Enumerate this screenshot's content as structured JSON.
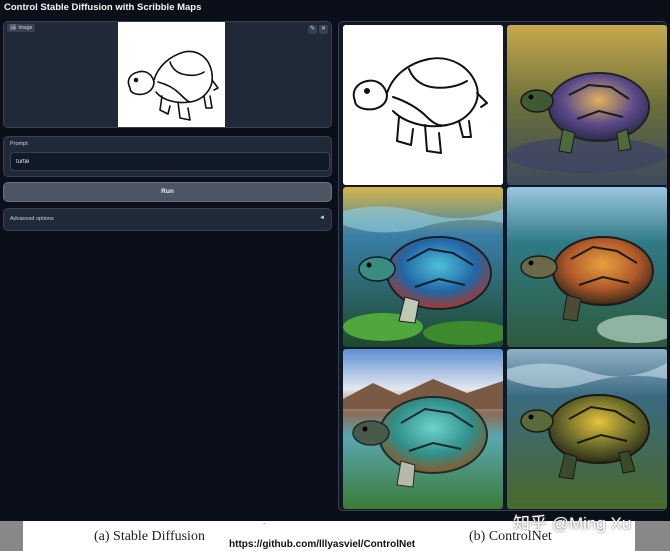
{
  "app": {
    "title": "Control Stable Diffusion with Scribble Maps"
  },
  "image_input": {
    "tag_label": "Image",
    "edit_icon": "pencil-icon",
    "close_icon": "close-icon"
  },
  "prompt": {
    "label": "Prompt",
    "value": "turtle"
  },
  "run": {
    "label": "Run"
  },
  "advanced": {
    "label": "Advanced options",
    "arrow": "◄"
  },
  "gallery": {
    "items": [
      {
        "name": "scribble-input-turtle"
      },
      {
        "name": "generated-turtle-1"
      },
      {
        "name": "generated-turtle-2"
      },
      {
        "name": "generated-turtle-3"
      },
      {
        "name": "generated-turtle-4"
      },
      {
        "name": "generated-turtle-5"
      }
    ]
  },
  "caption": {
    "left": "(a) Stable Diffusion",
    "right": "(b) ControlNet",
    "url": "https://github.com/lllyasviel/ControlNet",
    "dot": "."
  },
  "watermark": "知乎 @Ming Xu"
}
